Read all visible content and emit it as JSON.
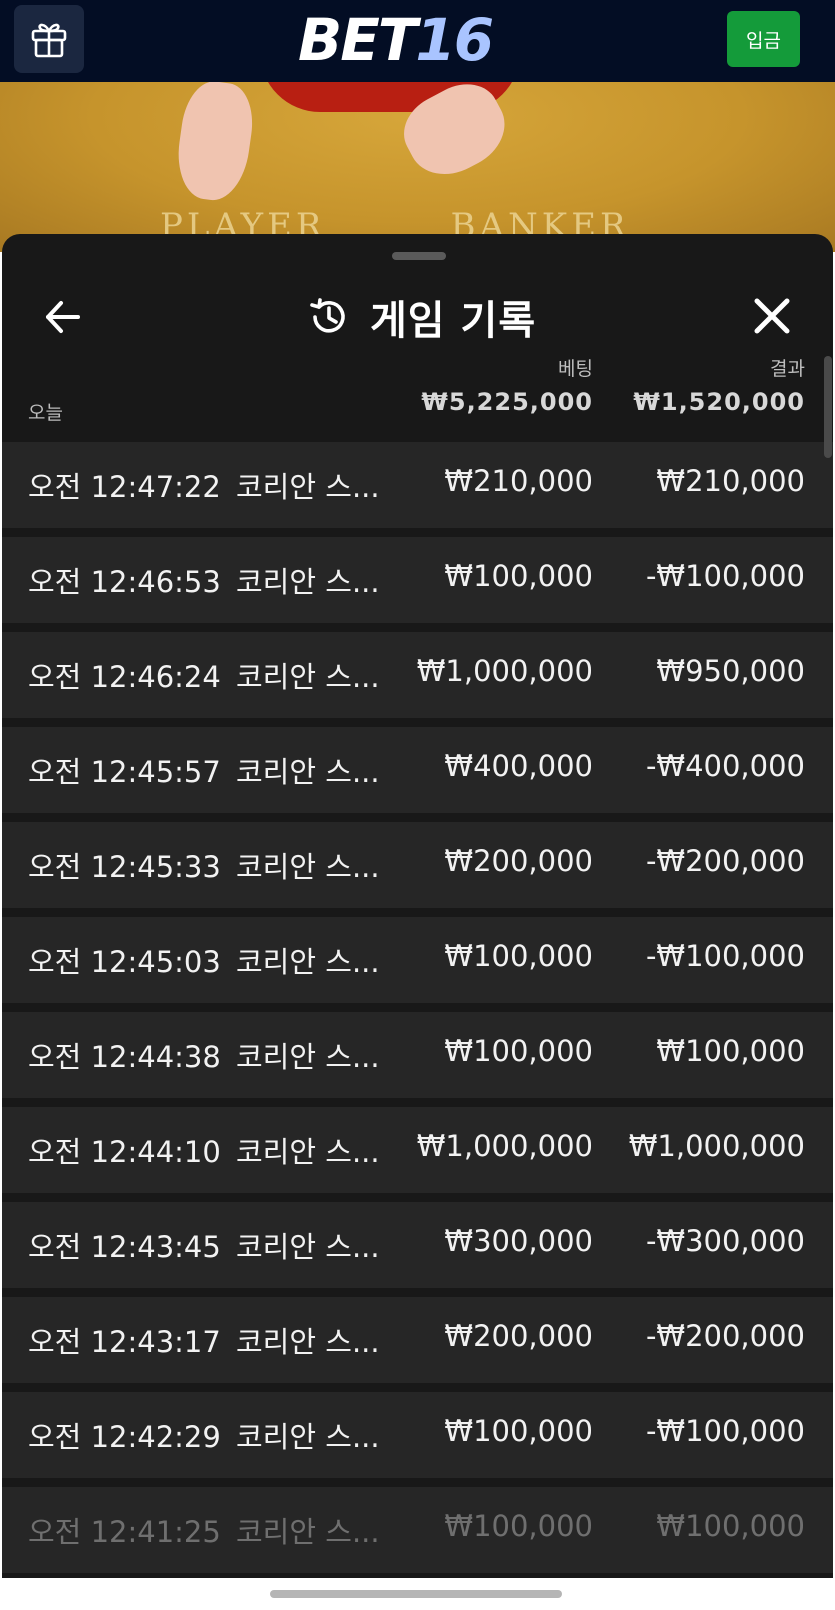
{
  "header": {
    "logo_bet": "BET",
    "logo_number": "16",
    "deposit_label": "입금",
    "gift_icon": "gift-icon"
  },
  "scene": {
    "player_label": "PLAYER",
    "banker_label": "BANKER"
  },
  "history": {
    "title": "게임 기록",
    "history_icon": "history-clock-icon",
    "back_icon": "arrow-left-icon",
    "close_icon": "close-icon",
    "col_bet_label": "베팅",
    "col_result_label": "결과",
    "today_label": "오늘",
    "total_bet": "₩5,225,000",
    "total_result": "₩1,520,000",
    "rows": [
      {
        "time": "오전 12:47:22",
        "game": "코리안 스...",
        "bet": "₩210,000",
        "result": "₩210,000"
      },
      {
        "time": "오전 12:46:53",
        "game": "코리안 스...",
        "bet": "₩100,000",
        "result": "-₩100,000"
      },
      {
        "time": "오전 12:46:24",
        "game": "코리안 스...",
        "bet": "₩1,000,000",
        "result": "₩950,000"
      },
      {
        "time": "오전 12:45:57",
        "game": "코리안 스...",
        "bet": "₩400,000",
        "result": "-₩400,000"
      },
      {
        "time": "오전 12:45:33",
        "game": "코리안 스...",
        "bet": "₩200,000",
        "result": "-₩200,000"
      },
      {
        "time": "오전 12:45:03",
        "game": "코리안 스...",
        "bet": "₩100,000",
        "result": "-₩100,000"
      },
      {
        "time": "오전 12:44:38",
        "game": "코리안 스...",
        "bet": "₩100,000",
        "result": "₩100,000"
      },
      {
        "time": "오전 12:44:10",
        "game": "코리안 스...",
        "bet": "₩1,000,000",
        "result": "₩1,000,000"
      },
      {
        "time": "오전 12:43:45",
        "game": "코리안 스...",
        "bet": "₩300,000",
        "result": "-₩300,000"
      },
      {
        "time": "오전 12:43:17",
        "game": "코리안 스...",
        "bet": "₩200,000",
        "result": "-₩200,000"
      },
      {
        "time": "오전 12:42:29",
        "game": "코리안 스...",
        "bet": "₩100,000",
        "result": "-₩100,000"
      },
      {
        "time": "오전 12:41:25",
        "game": "코리안 스...",
        "bet": "₩100,000",
        "result": "₩100,000"
      }
    ]
  },
  "colors": {
    "header_bg": "#030d24",
    "deposit_green": "#149b3a",
    "sheet_bg": "#181818",
    "row_bg": "#262626",
    "logo_accent": "#a9c4ff"
  }
}
